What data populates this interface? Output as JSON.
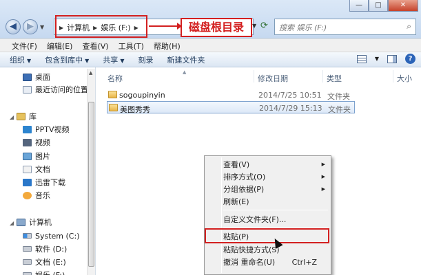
{
  "window": {
    "minimize": "—",
    "maximize": "□",
    "close": "✕"
  },
  "address": {
    "crumbs": [
      "计算机",
      "娱乐 (F:)"
    ],
    "annotation": "磁盘根目录"
  },
  "search": {
    "placeholder": "搜索 娱乐 (F:)"
  },
  "menubar": [
    "文件(F)",
    "编辑(E)",
    "查看(V)",
    "工具(T)",
    "帮助(H)"
  ],
  "toolbar": [
    "组织",
    "包含到库中",
    "共享",
    "刻录",
    "新建文件夹"
  ],
  "nav": {
    "desktop": "桌面",
    "recent": "最近访问的位置",
    "library": "库",
    "library_items": [
      "PPTV视频",
      "视频",
      "图片",
      "文档",
      "迅雷下载",
      "音乐"
    ],
    "computer": "计算机",
    "drives": [
      "System (C:)",
      "软件 (D:)",
      "文档 (E:)",
      "娱乐 (F:)"
    ]
  },
  "columns": {
    "name": "名称",
    "date": "修改日期",
    "type": "类型",
    "size": "大小"
  },
  "files": [
    {
      "name": "sogoupinyin",
      "date": "2014/7/25 10:51",
      "type": "文件夹"
    },
    {
      "name": "美图秀秀",
      "date": "2014/7/29 15:13",
      "type": "文件夹"
    }
  ],
  "context_menu": {
    "view": "查看(V)",
    "sort": "排序方式(O)",
    "group": "分组依据(P)",
    "refresh": "刷新(E)",
    "customize": "自定义文件夹(F)...",
    "paste": "粘贴(P)",
    "paste_shortcut": "粘贴快捷方式(S)",
    "undo": "撤消 重命名(U)",
    "undo_shortcut": "Ctrl+Z"
  }
}
